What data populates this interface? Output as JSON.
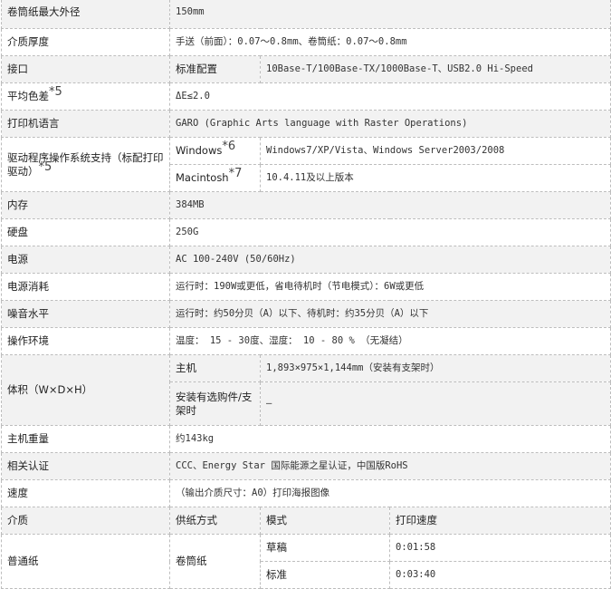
{
  "rows": {
    "roll_outer_dia": {
      "label": "卷筒纸最大外径",
      "value": "150mm"
    },
    "media_thickness": {
      "label": "介质厚度",
      "value": "手送（前面）：0.07〜0.8mm、卷筒纸：0.07〜0.8mm"
    },
    "interface": {
      "label": "接口",
      "sub": "标准配置",
      "value": "10Base-T/100Base-TX/1000Base-T、USB2.0 Hi-Speed"
    },
    "color_diff": {
      "label": "平均色差",
      "note": "*5",
      "value": "ΔE≤2.0"
    },
    "printer_lang": {
      "label": "打印机语言",
      "value": "GARO (Graphic Arts language with Raster Operations)"
    },
    "driver": {
      "label": "驱动程序操作系统支持（标配打印驱动）",
      "note": "*5",
      "windows": {
        "sub": "Windows",
        "note": "*6",
        "value": "Windows7/XP/Vista、Windows Server2003/2008"
      },
      "mac": {
        "sub": "Macintosh",
        "note": "*7",
        "value": "10.4.11及以上版本"
      }
    },
    "memory": {
      "label": "内存",
      "value": "384MB"
    },
    "hdd": {
      "label": "硬盘",
      "value": "250G"
    },
    "power": {
      "label": "电源",
      "value": "AC 100-240V (50/60Hz)"
    },
    "power_consumption": {
      "label": "电源消耗",
      "value": "运行时：190W或更低，省电待机时（节电模式）：6W或更低"
    },
    "noise": {
      "label": "噪音水平",
      "value": "运行时：约50分贝（A）以下、待机时：约35分贝（A）以下"
    },
    "environment": {
      "label": "操作环境",
      "value": "温度： 15 - 30度、湿度： 10 - 80 % （无凝结）"
    },
    "dimensions": {
      "label": "体积（W×D×H）",
      "main_sub": "主机",
      "main_value": "1,893×975×1,144mm（安装有支架时）",
      "option_sub": "安装有选购件/支架时",
      "option_value": "–"
    },
    "weight": {
      "label": "主机重量",
      "value": "约143kg"
    },
    "certification": {
      "label": "相关认证",
      "value": "CCC、Energy Star 国际能源之星认证，中国版RoHS"
    },
    "speed": {
      "label": "速度",
      "value": "（输出介质尺寸：A0）打印海报图像"
    },
    "speed_header": {
      "media": "介质",
      "feed": "供纸方式",
      "mode": "模式",
      "print_speed": "打印速度"
    },
    "plain_paper": {
      "media": "普通纸",
      "feed": "卷筒纸",
      "modes": [
        {
          "mode": "草稿",
          "speed": "0:01:58"
        },
        {
          "mode": "标准",
          "speed": "0:03:40"
        }
      ]
    }
  }
}
